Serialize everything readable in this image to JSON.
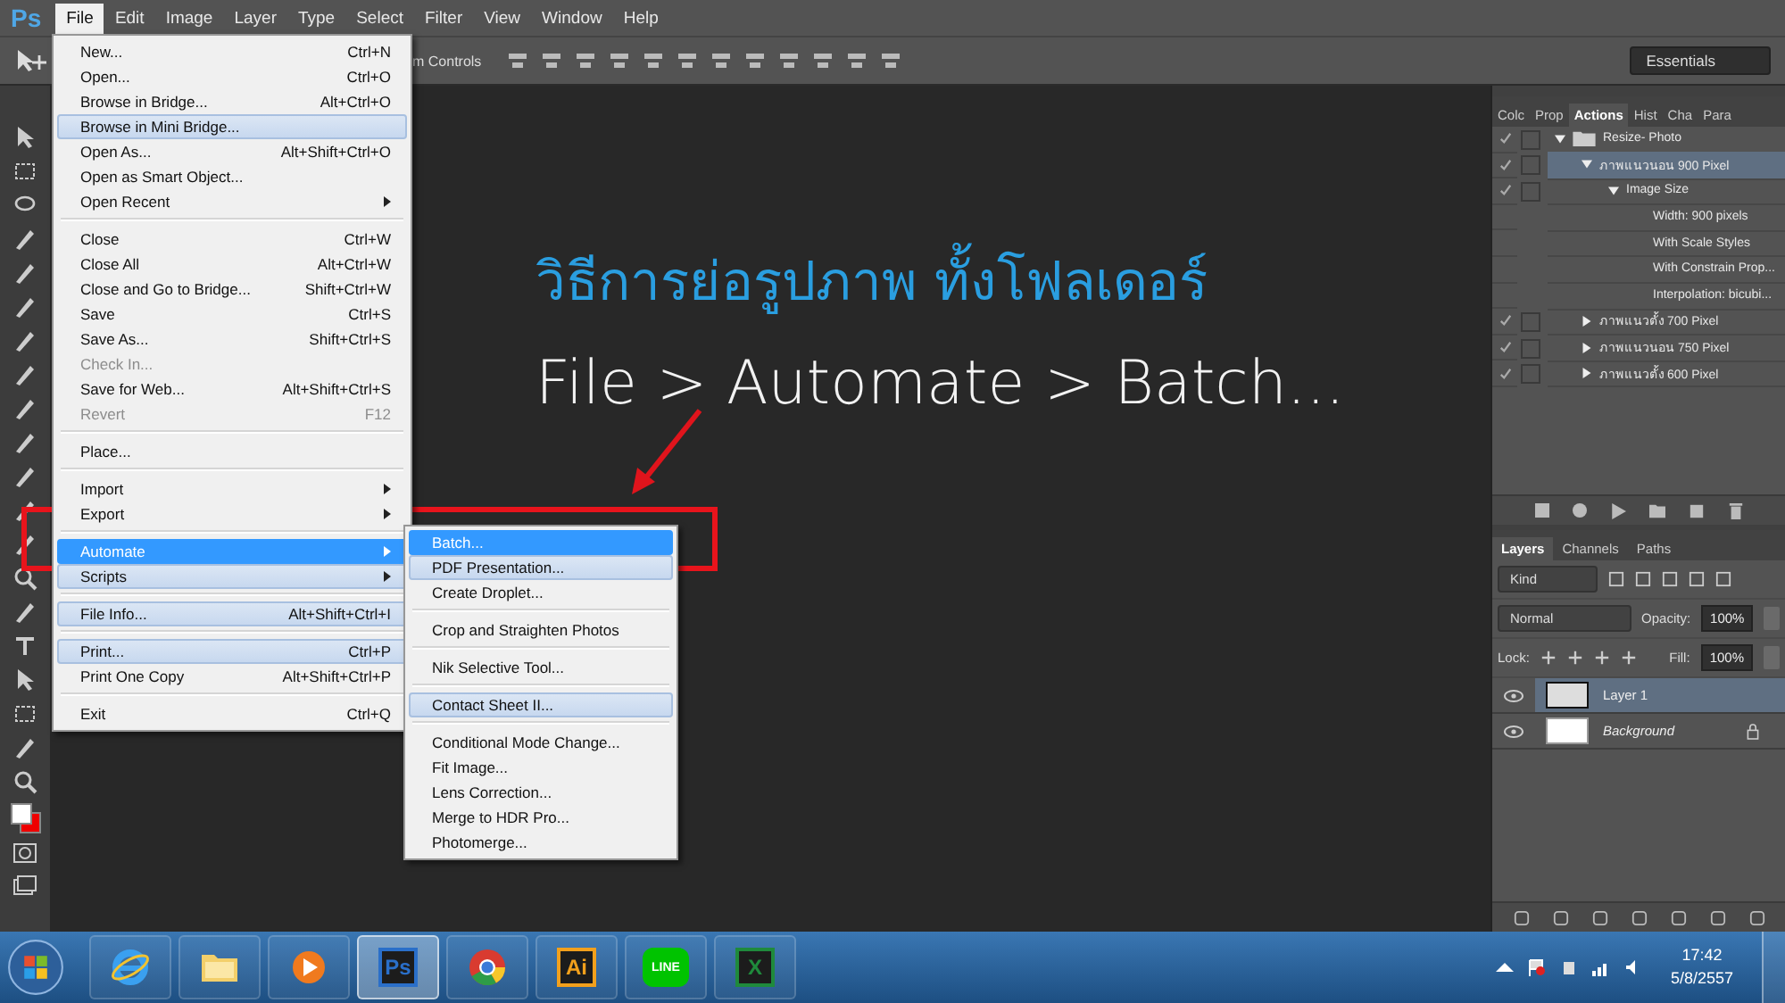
{
  "app_logo": "Ps",
  "menubar": [
    {
      "label": "File",
      "selected": true
    },
    {
      "label": "Edit",
      "selected": false
    },
    {
      "label": "Image",
      "selected": false
    },
    {
      "label": "Layer",
      "selected": false
    },
    {
      "label": "Type",
      "selected": false
    },
    {
      "label": "Select",
      "selected": false
    },
    {
      "label": "Filter",
      "selected": false
    },
    {
      "label": "View",
      "selected": false
    },
    {
      "label": "Window",
      "selected": false
    },
    {
      "label": "Help",
      "selected": false
    }
  ],
  "options_bar": {
    "partial_label": "m Controls",
    "workspace": "Essentials"
  },
  "file_menu": [
    {
      "kind": "item",
      "label": "New...",
      "shortcut": "Ctrl+N",
      "selected": false,
      "hovered": false,
      "disabled": false,
      "submenu": false
    },
    {
      "kind": "item",
      "label": "Open...",
      "shortcut": "Ctrl+O",
      "selected": false,
      "hovered": false,
      "disabled": false,
      "submenu": false
    },
    {
      "kind": "item",
      "label": "Browse in Bridge...",
      "shortcut": "Alt+Ctrl+O",
      "selected": false,
      "hovered": false,
      "disabled": false,
      "submenu": false
    },
    {
      "kind": "item",
      "label": "Browse in Mini Bridge...",
      "selected": false,
      "hovered": true,
      "disabled": false,
      "submenu": false
    },
    {
      "kind": "item",
      "label": "Open As...",
      "shortcut": "Alt+Shift+Ctrl+O",
      "selected": false,
      "hovered": false,
      "disabled": false,
      "submenu": false
    },
    {
      "kind": "item",
      "label": "Open as Smart Object...",
      "selected": false,
      "hovered": false,
      "disabled": false,
      "submenu": false
    },
    {
      "kind": "item",
      "label": "Open Recent",
      "selected": false,
      "hovered": false,
      "disabled": false,
      "submenu": true
    },
    {
      "kind": "separator"
    },
    {
      "kind": "item",
      "label": "Close",
      "shortcut": "Ctrl+W",
      "selected": false,
      "hovered": false,
      "disabled": false,
      "submenu": false
    },
    {
      "kind": "item",
      "label": "Close All",
      "shortcut": "Alt+Ctrl+W",
      "selected": false,
      "hovered": false,
      "disabled": false,
      "submenu": false
    },
    {
      "kind": "item",
      "label": "Close and Go to Bridge...",
      "shortcut": "Shift+Ctrl+W",
      "selected": false,
      "hovered": false,
      "disabled": false,
      "submenu": false
    },
    {
      "kind": "item",
      "label": "Save",
      "shortcut": "Ctrl+S",
      "selected": false,
      "hovered": false,
      "disabled": false,
      "submenu": false
    },
    {
      "kind": "item",
      "label": "Save As...",
      "shortcut": "Shift+Ctrl+S",
      "selected": false,
      "hovered": false,
      "disabled": false,
      "submenu": false
    },
    {
      "kind": "item",
      "label": "Check In...",
      "selected": false,
      "hovered": false,
      "disabled": true,
      "submenu": false
    },
    {
      "kind": "item",
      "label": "Save for Web...",
      "shortcut": "Alt+Shift+Ctrl+S",
      "selected": false,
      "hovered": false,
      "disabled": false,
      "submenu": false
    },
    {
      "kind": "item",
      "label": "Revert",
      "shortcut": "F12",
      "selected": false,
      "hovered": false,
      "disabled": true,
      "submenu": false
    },
    {
      "kind": "separator"
    },
    {
      "kind": "item",
      "label": "Place...",
      "selected": false,
      "hovered": false,
      "disabled": false,
      "submenu": false
    },
    {
      "kind": "separator"
    },
    {
      "kind": "item",
      "label": "Import",
      "selected": false,
      "hovered": false,
      "disabled": false,
      "submenu": true
    },
    {
      "kind": "item",
      "label": "Export",
      "selected": false,
      "hovered": false,
      "disabled": false,
      "submenu": true
    },
    {
      "kind": "separator"
    },
    {
      "kind": "item",
      "label": "Automate",
      "selected": true,
      "hovered": false,
      "disabled": false,
      "submenu": true
    },
    {
      "kind": "item",
      "label": "Scripts",
      "selected": false,
      "hovered": true,
      "disabled": false,
      "submenu": true
    },
    {
      "kind": "separator"
    },
    {
      "kind": "item",
      "label": "File Info...",
      "shortcut": "Alt+Shift+Ctrl+I",
      "selected": false,
      "hovered": true,
      "disabled": false,
      "submenu": false
    },
    {
      "kind": "separator"
    },
    {
      "kind": "item",
      "label": "Print...",
      "shortcut": "Ctrl+P",
      "selected": false,
      "hovered": true,
      "disabled": false,
      "submenu": false
    },
    {
      "kind": "item",
      "label": "Print One Copy",
      "shortcut": "Alt+Shift+Ctrl+P",
      "selected": false,
      "hovered": false,
      "disabled": false,
      "submenu": false
    },
    {
      "kind": "separator"
    },
    {
      "kind": "item",
      "label": "Exit",
      "shortcut": "Ctrl+Q",
      "selected": false,
      "hovered": false,
      "disabled": false,
      "submenu": false
    }
  ],
  "automate_menu": [
    {
      "kind": "item",
      "label": "Batch...",
      "selected": true,
      "hovered": false
    },
    {
      "kind": "item",
      "label": "PDF Presentation...",
      "selected": false,
      "hovered": true
    },
    {
      "kind": "item",
      "label": "Create Droplet...",
      "selected": false,
      "hovered": false
    },
    {
      "kind": "separator"
    },
    {
      "kind": "item",
      "label": "Crop and Straighten Photos",
      "selected": false,
      "hovered": false
    },
    {
      "kind": "separator"
    },
    {
      "kind": "item",
      "label": "Nik Selective Tool...",
      "selected": false,
      "hovered": false
    },
    {
      "kind": "separator"
    },
    {
      "kind": "item",
      "label": "Contact Sheet II...",
      "selected": false,
      "hovered": true
    },
    {
      "kind": "separator"
    },
    {
      "kind": "item",
      "label": "Conditional Mode Change...",
      "selected": false,
      "hovered": false
    },
    {
      "kind": "item",
      "label": "Fit Image...",
      "selected": false,
      "hovered": false
    },
    {
      "kind": "item",
      "label": "Lens Correction...",
      "selected": false,
      "hovered": false
    },
    {
      "kind": "item",
      "label": "Merge to HDR Pro...",
      "selected": false,
      "hovered": false
    },
    {
      "kind": "item",
      "label": "Photomerge...",
      "selected": false,
      "hovered": false
    }
  ],
  "headline": {
    "title": "วิธีการย่อรูปภาพ ทั้งโฟลเดอร์",
    "path": "File > Automate > Batch..."
  },
  "actions_panel": {
    "tabs": [
      {
        "label": "Colc",
        "selected": false
      },
      {
        "label": "Prop",
        "selected": false
      },
      {
        "label": "Actions",
        "selected": true
      },
      {
        "label": "Hist",
        "selected": false
      },
      {
        "label": "Cha",
        "selected": false
      },
      {
        "label": "Para",
        "selected": false
      }
    ],
    "items": [
      {
        "kind": "set",
        "label": "Resize- Photo",
        "checked": true,
        "expanded": true,
        "selected": false,
        "children": [
          {
            "kind": "command",
            "label": "ภาพแนวนอน  900 Pixel",
            "checked": true,
            "expanded": true,
            "selected": true,
            "children": [
              {
                "kind": "command",
                "label": "Image Size",
                "checked": true,
                "expanded": true,
                "selected": false,
                "children": [
                  {
                    "kind": "detail",
                    "label": "Width: 900 pixels"
                  },
                  {
                    "kind": "detail",
                    "label": "With Scale Styles"
                  },
                  {
                    "kind": "detail",
                    "label": "With Constrain Prop..."
                  },
                  {
                    "kind": "detail",
                    "label": "Interpolation: bicubi..."
                  }
                ]
              }
            ]
          },
          {
            "kind": "command",
            "label": "ภาพแนวตั้ง  700 Pixel",
            "checked": true,
            "expanded": false,
            "selected": false
          },
          {
            "kind": "command",
            "label": "ภาพแนวนอน  750 Pixel",
            "checked": true,
            "expanded": false,
            "selected": false
          },
          {
            "kind": "command",
            "label": "ภาพแนวตั้ง  600 Pixel",
            "checked": true,
            "expanded": false,
            "selected": false
          }
        ]
      }
    ]
  },
  "layers_panel": {
    "tabs": [
      {
        "label": "Layers",
        "selected": true
      },
      {
        "label": "Channels",
        "selected": false
      },
      {
        "label": "Paths",
        "selected": false
      }
    ],
    "filter": "Kind",
    "blend_mode": "Normal",
    "opacity_label": "Opacity:",
    "opacity": "100%",
    "lock_label": "Lock:",
    "fill_label": "Fill:",
    "fill": "100%",
    "layers": [
      {
        "kind": "layer",
        "name": "Layer 1",
        "selected": true,
        "visible": true
      },
      {
        "kind": "background",
        "name": "Background",
        "selected": false,
        "visible": true
      }
    ]
  },
  "taskbar": {
    "apps": [
      {
        "kind": "ie",
        "selected": false
      },
      {
        "kind": "folder",
        "selected": false
      },
      {
        "kind": "media",
        "selected": false
      },
      {
        "kind": "letters",
        "label": "Ps",
        "color": "#2a6fc9",
        "selected": true
      },
      {
        "kind": "chrome",
        "selected": false
      },
      {
        "kind": "letters",
        "label": "Ai",
        "color": "#f2a01c",
        "selected": false
      },
      {
        "kind": "bubble",
        "label": "LINE",
        "color": "#00c300",
        "selected": false
      },
      {
        "kind": "letters",
        "label": "X",
        "color": "#1f8a3c",
        "selected": false
      }
    ],
    "time": "17:42",
    "date": "5/8/2557"
  }
}
